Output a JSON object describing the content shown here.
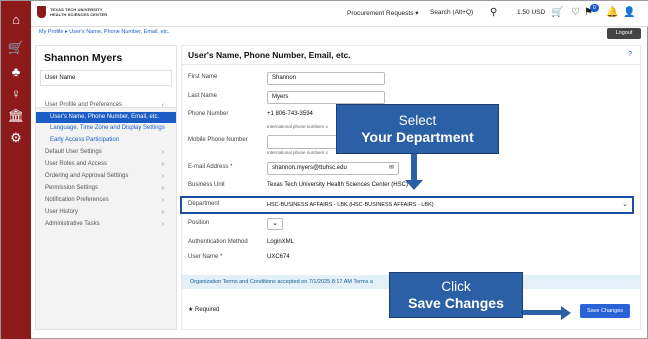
{
  "rail_icons": [
    {
      "name": "home-icon",
      "glyph": "⌂"
    },
    {
      "name": "cart-icon",
      "glyph": "🛒"
    },
    {
      "name": "tasks-icon",
      "glyph": "♣"
    },
    {
      "name": "account-icon",
      "glyph": "♀"
    },
    {
      "name": "institution-icon",
      "glyph": "🏛"
    },
    {
      "name": "settings-icon",
      "glyph": "⚙"
    }
  ],
  "logo": {
    "line1": "TEXAS TECH UNIVERSITY",
    "line2": "HEALTH SCIENCES CENTER"
  },
  "topbar": {
    "procurement": "Procurement Requests ▾",
    "search": "Search (Alt+Q)",
    "search_icon": "⚲",
    "balance": "1.50 USD",
    "cart_icon": "🛒",
    "heart_icon": "♡",
    "flag_icon": "⚑",
    "badge": "0",
    "bell_icon": "🔔",
    "user_icon": "👤"
  },
  "breadcrumb": "My Profile ▸ User's Name, Phone Number, Email, etc.",
  "logout": "Logout",
  "profile": {
    "name": "Shannon Myers",
    "user_name_label": "User Name"
  },
  "menu": [
    {
      "label": "User Profile and Preferences",
      "chevron": "‹",
      "type": "header"
    },
    {
      "label": "User's Name, Phone Number, Email, etc.",
      "chevron": "",
      "type": "active"
    },
    {
      "label": "Language, Time Zone and Display Settings",
      "chevron": "",
      "type": "sub"
    },
    {
      "label": "Early Access Participation",
      "chevron": "",
      "type": "sub"
    },
    {
      "label": "Default User Settings",
      "chevron": "›",
      "type": "header"
    },
    {
      "label": "User Roles and Access",
      "chevron": "›",
      "type": "header"
    },
    {
      "label": "Ordering and Approval Settings",
      "chevron": "›",
      "type": "header"
    },
    {
      "label": "Permission Settings",
      "chevron": "›",
      "type": "header"
    },
    {
      "label": "Notification Preferences",
      "chevron": "›",
      "type": "header"
    },
    {
      "label": "User History",
      "chevron": "›",
      "type": "header"
    },
    {
      "label": "Administrative Tasks",
      "chevron": "›",
      "type": "header"
    }
  ],
  "main": {
    "title": "User's Name, Phone Number, Email, etc.",
    "help": "?",
    "first_name_label": "First Name",
    "first_name": "Shannon",
    "last_name_label": "Last Name",
    "last_name": "Myers",
    "phone_label": "Phone Number",
    "phone": "+1 806-743-3594",
    "phone_hint": "International phone numbers s",
    "mobile_label": "Mobile Phone Number",
    "mobile": "",
    "mobile_hint": "International phone numbers s",
    "email_label": "E-mail Address *",
    "email": "shannon.myers@ttuhsc.edu",
    "email_icon": "✉",
    "business_unit_label": "Business Unit",
    "business_unit": "Texas Tech University Health Sciences Center (HSC)",
    "department_label": "Department",
    "department": "HSC-BUSINESS AFFAIRS - LBK (HSC-BUSINESS AFFAIRS - LBK)",
    "department_chevron": "⌄",
    "position_label": "Position",
    "position_chevron": "⌄",
    "auth_label": "Authentication Method",
    "auth": "LoginXML",
    "username_label": "User Name *",
    "username": "UXC674",
    "terms": "Organization Terms and Conditions accepted on 7/1/2025 8:17 AM Terms a",
    "required": "★ Required",
    "save": "Save Changes"
  },
  "callouts": {
    "dept_line1": "Select",
    "dept_line2": "Your Department",
    "save_line1": "Click",
    "save_line2": "Save Changes"
  },
  "colors": {
    "rail": "#8c1a1a",
    "accent": "#1b5dc4",
    "callout": "#2b5fa6"
  }
}
